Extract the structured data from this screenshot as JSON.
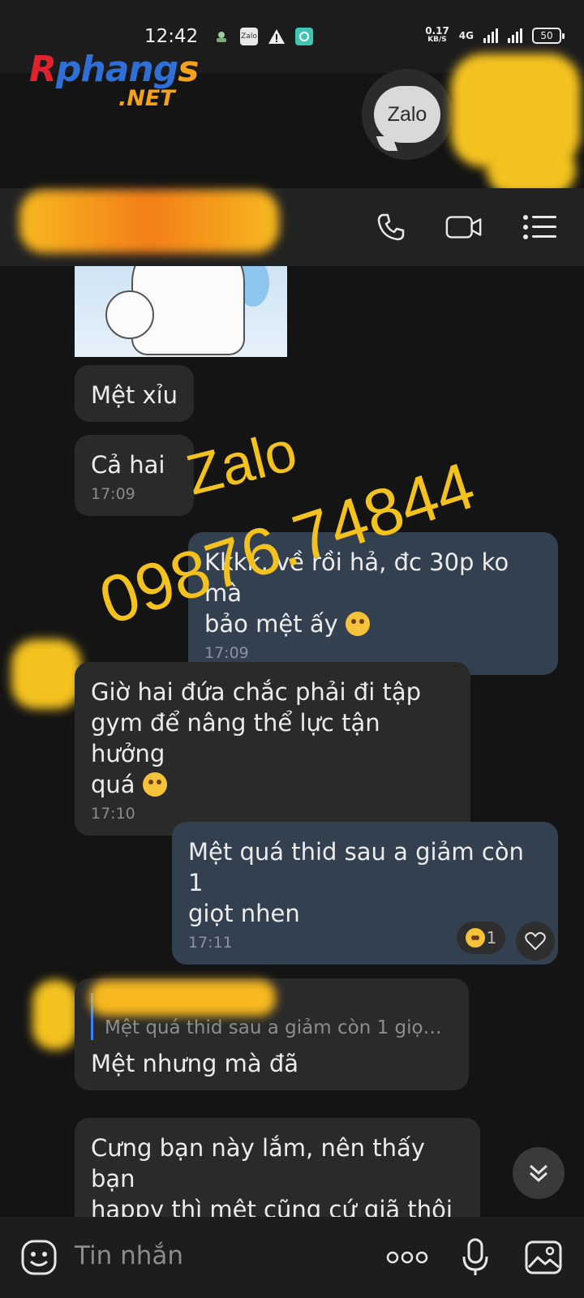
{
  "status_bar": {
    "time": "12:42",
    "net_speed_value": "0.17",
    "net_speed_unit": "KB/S",
    "network": "4G",
    "battery": "50"
  },
  "watermark": {
    "brand_main": "Rphangs",
    "brand_net": ".NET",
    "zalo_badge": "Zalo",
    "overlay_app": "Zalo",
    "overlay_phone": "09876.74844"
  },
  "header": {
    "contact_name": "",
    "icons": [
      "phone-icon",
      "video-call-icon",
      "menu-icon"
    ]
  },
  "messages": [
    {
      "id": "m1",
      "side": "in",
      "text": "Mệt xỉu",
      "time": ""
    },
    {
      "id": "m2",
      "side": "in",
      "text": "Cả hai",
      "time": "17:09"
    },
    {
      "id": "m3",
      "side": "out",
      "text_line1": "Kkkk, về rồi hả, đc 30p ko mà",
      "text_line2": "bảo mệt ấy",
      "time": "17:09"
    },
    {
      "id": "m4",
      "side": "in",
      "text_line1": "Giờ hai đứa chắc phải đi tập",
      "text_line2": "gym để nâng thể lực tận hưởng",
      "text_line3": "quá",
      "time": "17:10"
    },
    {
      "id": "m5",
      "side": "out",
      "text_line1": "Mệt quá thid sau a giảm còn 1",
      "text_line2": "giọt nhen",
      "time": "17:11",
      "reaction_count": "1"
    },
    {
      "id": "m6",
      "side": "in",
      "reply_to": "Mệt quá thid sau a giảm còn 1 giọt...",
      "text": "Mệt nhưng mà đã"
    },
    {
      "id": "m7",
      "side": "in",
      "text_line1": "Cưng bạn này lắm, nên thấy bạn",
      "text_line2": "happy thì mệt cũng cứ giã thôi"
    }
  ],
  "input": {
    "placeholder": "Tin nhắn",
    "icons": [
      "emoji-icon",
      "more-icon",
      "microphone-icon",
      "image-icon"
    ]
  },
  "colors": {
    "background": "#141414",
    "incoming_bubble": "#2a2a2a",
    "outgoing_bubble": "#334050",
    "watermark_yellow": "#f4c21f"
  }
}
